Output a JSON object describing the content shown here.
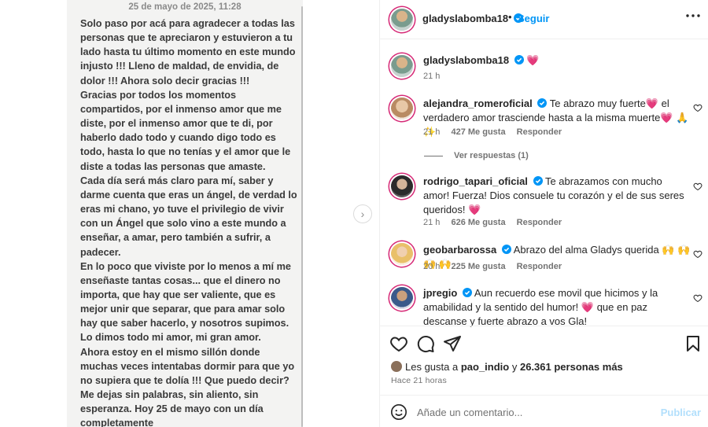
{
  "note": {
    "date": "25 de mayo de 2025, 11:28",
    "paragraphs": [
      "Solo paso por acá para agradecer a todas las personas que te apreciaron y estuvieron a tu lado hasta tu último momento en este mundo injusto !!!  Lleno de maldad, de envidia, de dolor !!! Ahora solo decir gracias !!!",
      "Gracias por todos los momentos compartidos, por el inmenso amor que me diste, por el inmenso amor que te di, por haberlo dado todo y cuando digo todo es todo, hasta lo que no tenías y el amor que le diste a todas las personas que amaste.",
      "Cada día será más claro para mí, saber y darme cuenta  que eras un ángel, de verdad lo eras mi chano, yo tuve el privilegio de vivir con un Ángel que solo vino  a este mundo a enseñar, a amar, pero también a sufrir, a padecer.",
      "En lo poco  que viviste por lo menos a mí  me enseñaste  tantas  cosas... que el dinero no importa, que hay que ser valiente, que es mejor unir que separar, que  para  amar solo hay que  saber hacerlo, y nosotros  supimos. Lo dimos todo mi amor, mi gran amor.",
      "Ahora estoy  en el mismo sillón donde muchas veces  intentabas dormir para que yo no supiera que te dolía !!!  Que puedo  decir? Me dejas sin palabras, sin aliento, sin esperanza. Hoy 25 de mayo con un día  completamente"
    ]
  },
  "header": {
    "username": "gladyslabomba18",
    "separator": "•",
    "follow_label": "Seguir"
  },
  "caption": {
    "username": "gladyslabomba18",
    "text": "💗",
    "time": "21 h"
  },
  "comments": [
    {
      "username": "alejandra_romeroficial",
      "text": "Te abrazo muy fuerte💗 el verdadero amor trasciende hasta a la misma muerte💗 🙏 ✨",
      "time": "21 h",
      "likes": "427 Me gusta",
      "reply": "Responder"
    },
    {
      "username": "rodrigo_tapari_oficial",
      "text": "Te abrazamos con mucho amor! Fuerza! Dios consuele tu corazón y el de sus seres queridos! 💗",
      "time": "21 h",
      "likes": "626 Me gusta",
      "reply": "Responder"
    },
    {
      "username": "geobarbarossa",
      "text": "Abrazo del alma Gladys querida 🙌 🙌 🙌 🙌",
      "time": "20 h",
      "likes": "225 Me gusta",
      "reply": "Responder"
    },
    {
      "username": "jpregio",
      "text": "Aun recuerdo ese movil que hicimos y la amabilidad y la sentido del humor! 💗 que en paz descanse y fuerte abrazo a vos Gla!",
      "time": "",
      "likes": "",
      "reply": ""
    }
  ],
  "view_replies": "Ver respuestas (1)",
  "likes_line": {
    "prefix": "Les gusta a",
    "user": "pao_indio",
    "connector": "y",
    "count": "26.361 personas más"
  },
  "time_ago": "Hace 21 horas",
  "composer": {
    "placeholder": "Añade un comentario...",
    "publish": "Publicar"
  },
  "colors": {
    "accent": "#0095f6",
    "heart": "#e0245e",
    "muted": "#737373"
  }
}
